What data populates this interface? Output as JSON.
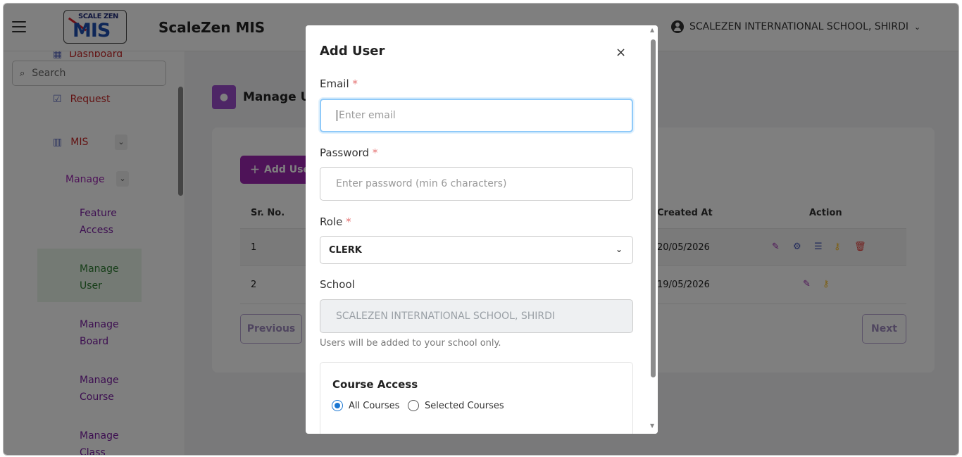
{
  "header": {
    "app_title": "ScaleZen MIS",
    "logo_text_top": "SCALE ZEN",
    "logo_text_main": "MIS",
    "school_name": "SCALEZEN INTERNATIONAL SCHOOL, SHIRDI"
  },
  "sidebar": {
    "dashboard": "Dashboard",
    "search_placeholder": "Search",
    "request": "Request",
    "mis": "MIS",
    "manage": "Manage",
    "items": [
      "Feature",
      "Access",
      "Manage",
      "User",
      "Manage",
      "Board",
      "Manage",
      "Course",
      "Manage",
      "Class"
    ]
  },
  "main": {
    "page_title": "Manage Us",
    "add_button": "Add User",
    "columns": {
      "sr_no": "Sr. No.",
      "created_at": "Created At",
      "action": "Action"
    },
    "rows": [
      {
        "sr": "1",
        "created": "20/05/2026"
      },
      {
        "sr": "2",
        "created": "19/05/2026"
      }
    ],
    "previous": "Previous",
    "next": "Next"
  },
  "modal": {
    "title": "Add User",
    "close": "×",
    "email_label": "Email",
    "email_placeholder": "Enter email",
    "password_label": "Password",
    "password_placeholder": "Enter password (min 6 characters)",
    "role_label": "Role",
    "role_value": "CLERK",
    "school_label": "School",
    "school_value": "SCALEZEN INTERNATIONAL SCHOOL, SHIRDI",
    "school_hint": "Users will be added to your school only.",
    "course_access_title": "Course Access",
    "radio_all": "All Courses",
    "radio_selected": "Selected Courses",
    "required_mark": "*"
  },
  "colors": {
    "accent": "#9c27b0",
    "focus": "#90caf9",
    "radio": "#1976d2"
  }
}
